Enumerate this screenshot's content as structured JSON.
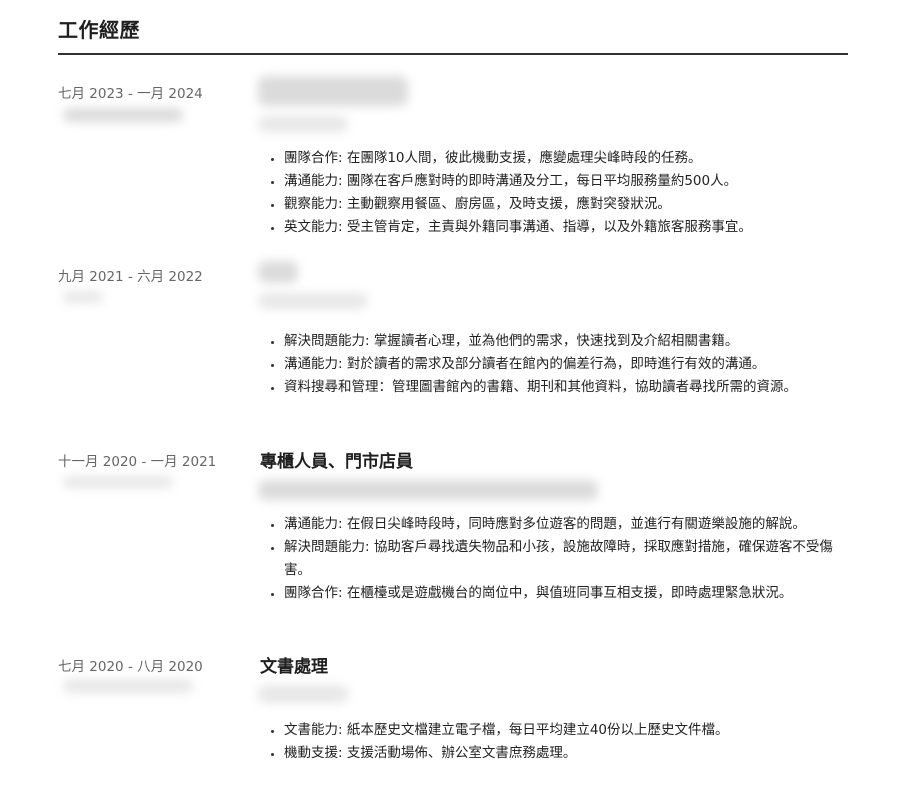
{
  "section": {
    "title": "工作經歷"
  },
  "entries": [
    {
      "date": "七月 2023 - 一月 2024",
      "title": "",
      "bullets": [
        "團隊合作: 在團隊10人間，彼此機動支援，應變處理尖峰時段的任務。",
        "溝通能力: 團隊在客戶應對時的即時溝通及分工，每日平均服務量約500人。",
        "觀察能力: 主動觀察用餐區、廚房區，及時支援，應對突發狀況。",
        "英文能力: 受主管肯定，主責與外籍同事溝通、指導，以及外籍旅客服務事宜。"
      ]
    },
    {
      "date": "九月 2021 - 六月 2022",
      "title": "",
      "bullets": [
        "解決問題能力: 掌握讀者心理，並為他們的需求，快速找到及介紹相關書籍。",
        "溝通能力: 對於讀者的需求及部分讀者在館內的偏差行為，即時進行有效的溝通。",
        "資料搜尋和管理：管理圖書館內的書籍、期刊和其他資料，協助讀者尋找所需的資源。"
      ]
    },
    {
      "date": "十一月 2020 - 一月 2021",
      "title": "專櫃人員、門市店員",
      "bullets": [
        "溝通能力: 在假日尖峰時段時，同時應對多位遊客的問題，並進行有關遊樂設施的解說。",
        "解決問題能力: 協助客戶尋找遺失物品和小孩，設施故障時，採取應對措施，確保遊客不受傷害。",
        "團隊合作: 在櫃檯或是遊戲機台的崗位中，與值班同事互相支援，即時處理緊急狀況。"
      ]
    },
    {
      "date": "七月 2020 - 八月 2020",
      "title": "文書處理",
      "bullets": [
        "文書能力: 紙本歷史文檔建立電子檔，每日平均建立40份以上歷史文件檔。",
        "機動支援: 支援活動場佈、辦公室文書庶務處理。"
      ]
    }
  ]
}
